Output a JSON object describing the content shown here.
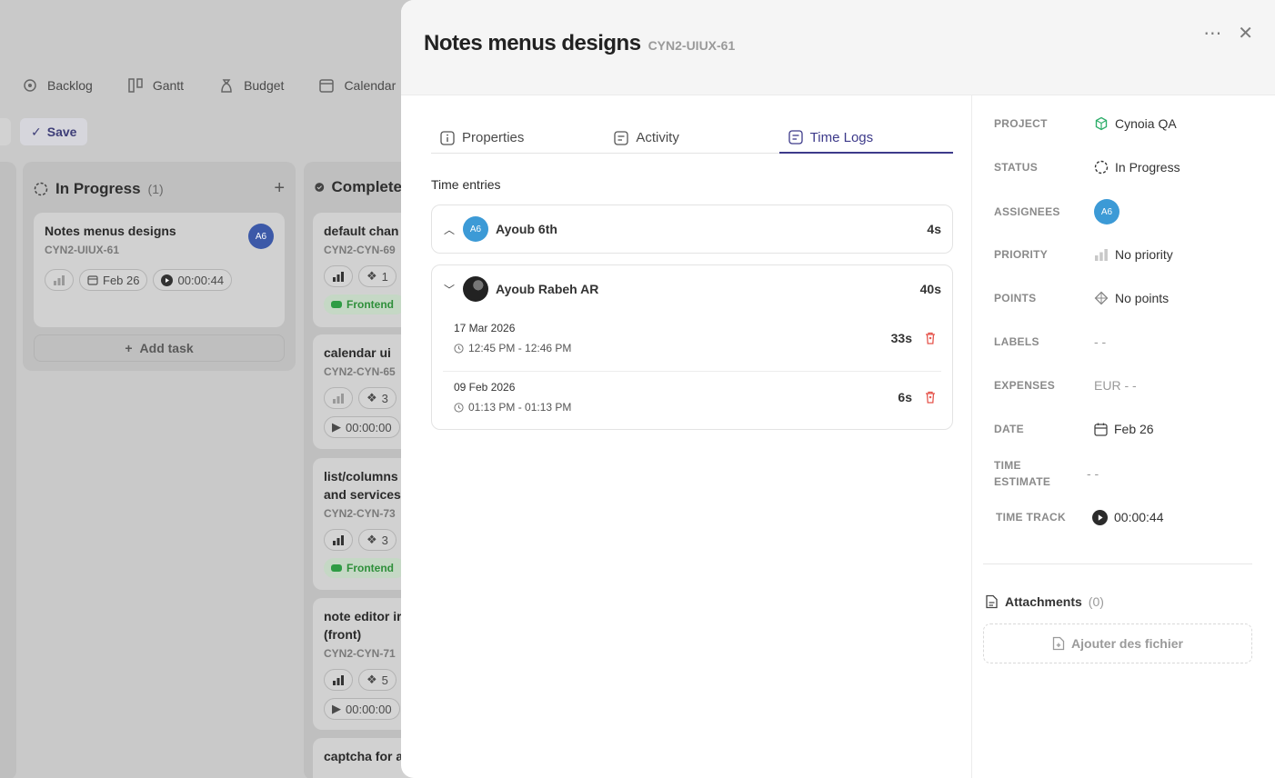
{
  "board": {
    "view_tabs": [
      "Backlog",
      "Gantt",
      "Budget",
      "Calendar"
    ],
    "save_label": "Save",
    "in_progress": {
      "title": "In Progress",
      "count": "(1)",
      "card": {
        "title": "Notes menus designs",
        "id": "CYN2-UIUX-61",
        "avatar": "A6",
        "date": "Feb 26",
        "timer": "00:00:44"
      },
      "add_task": "Add task"
    },
    "completed": {
      "title": "Complete",
      "cards": [
        {
          "title": "default chan",
          "id": "CYN2-CYN-69",
          "points": "1",
          "tag": "Frontend"
        },
        {
          "title": "calendar ui",
          "id": "CYN2-CYN-65",
          "points": "3",
          "timer": "00:00:00"
        },
        {
          "title": "list/columns",
          "title2": "and services",
          "id": "CYN2-CYN-73",
          "points": "3",
          "tag": "Frontend"
        },
        {
          "title": "note editor ir",
          "title2": "(front)",
          "id": "CYN2-CYN-71",
          "points": "5",
          "timer": "00:00:00"
        },
        {
          "title": "captcha for a"
        }
      ]
    }
  },
  "panel": {
    "title": "Notes menus designs",
    "task_id": "CYN2-UIUX-61",
    "tabs": [
      "Properties",
      "Activity",
      "Time Logs"
    ],
    "active_tab": "Time Logs",
    "section_label": "Time entries",
    "entries": [
      {
        "user": "Ayoub 6th",
        "avatar": "A6",
        "total": "4s",
        "expanded": false
      },
      {
        "user": "Ayoub Rabeh AR",
        "total": "40s",
        "expanded": true,
        "logs": [
          {
            "date": "17 Mar 2026",
            "range": "12:45 PM - 12:46 PM",
            "duration": "33s"
          },
          {
            "date": "09 Feb 2026",
            "range": "01:13 PM - 01:13 PM",
            "duration": "6s"
          }
        ]
      }
    ]
  },
  "properties": {
    "project_label": "PROJECT",
    "project_value": "Cynoia QA",
    "status_label": "STATUS",
    "status_value": "In Progress",
    "assignees_label": "ASSIGNEES",
    "assignee_avatar": "A6",
    "priority_label": "PRIORITY",
    "priority_value": "No priority",
    "points_label": "POINTS",
    "points_value": "No points",
    "labels_label": "LABELS",
    "labels_value": "- -",
    "expenses_label": "EXPENSES",
    "expenses_value": "EUR - -",
    "date_label": "DATE",
    "date_value": "Feb 26",
    "time_estimate_label_1": "TIME",
    "time_estimate_label_2": "ESTIMATE",
    "time_estimate_value": "- -",
    "time_track_label": "TIME TRACK",
    "time_track_value": "00:00:44",
    "attachments_label": "Attachments",
    "attachments_count": "(0)",
    "upload_label": "Ajouter des fichier"
  },
  "colors": {
    "accent": "#3d3a8a",
    "project_icon": "#2fae6b",
    "danger": "#e5534b",
    "frontend_tag": "#2e9c44"
  }
}
